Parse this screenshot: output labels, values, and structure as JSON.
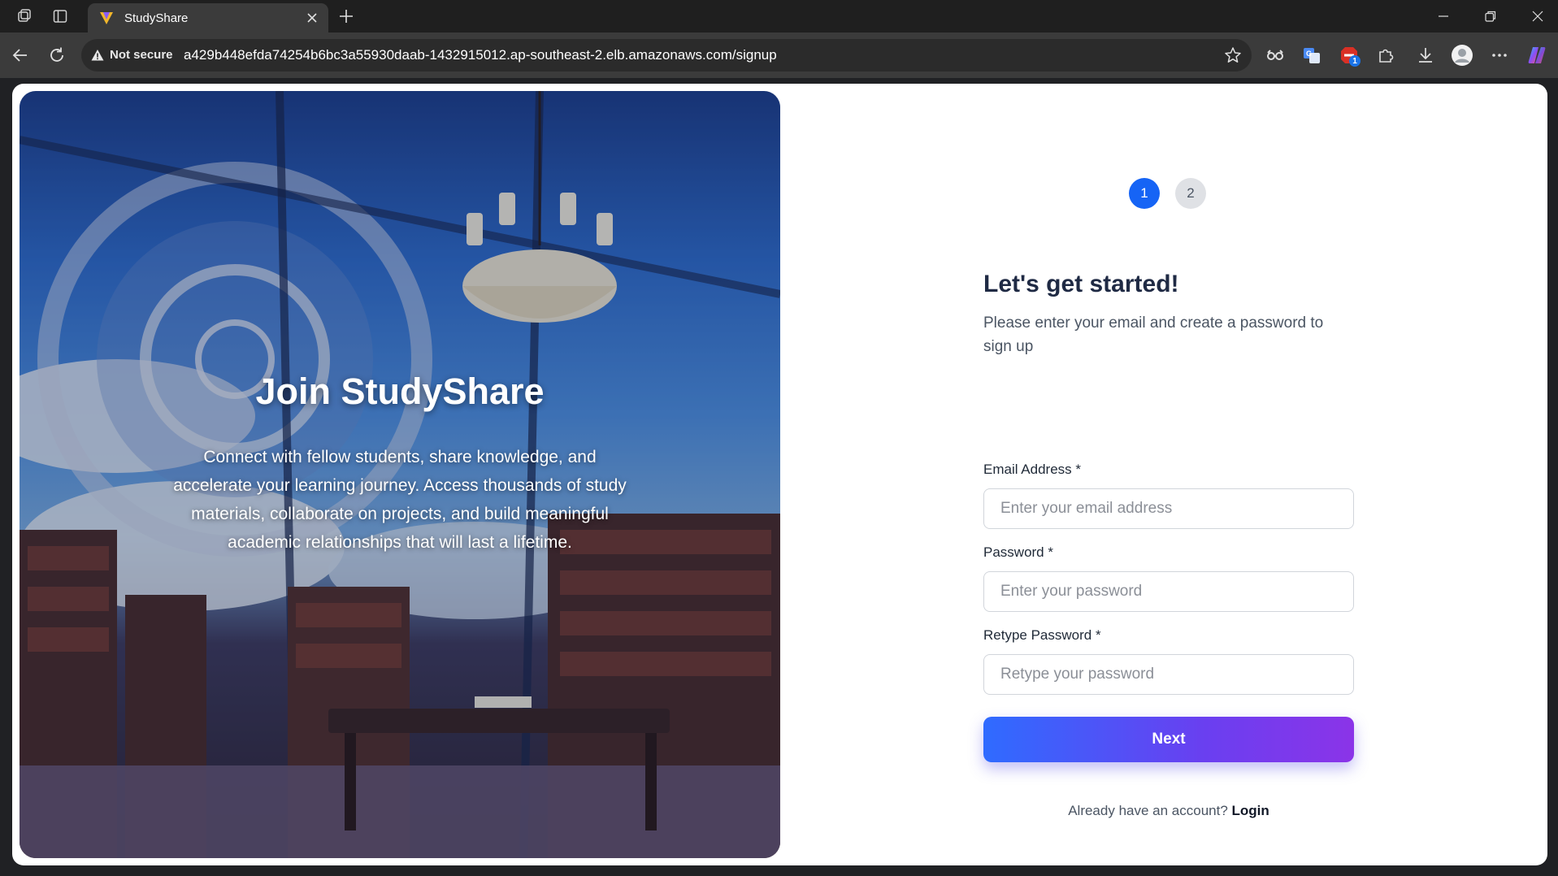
{
  "browser": {
    "tab_title": "StudyShare",
    "security_label": "Not secure",
    "url": "a429b448efda74254b6bc3a55930daab-1432915012.ap-southeast-2.elb.amazonaws.com/signup",
    "extension_badge": "1"
  },
  "hero": {
    "title": "Join StudyShare",
    "description": "Connect with fellow students, share knowledge, and accelerate your learning journey. Access thousands of study materials, collaborate on projects, and build meaningful academic relationships that will last a lifetime."
  },
  "stepper": {
    "steps": [
      "1",
      "2"
    ],
    "active_step": "1"
  },
  "form": {
    "heading": "Let's get started!",
    "subheading": "Please enter your email and create a password to sign up",
    "email": {
      "label": "Email Address *",
      "placeholder": "Enter your email address"
    },
    "password": {
      "label": "Password *",
      "placeholder": "Enter your password"
    },
    "retype_password": {
      "label": "Retype Password *",
      "placeholder": "Retype your password"
    },
    "next_label": "Next",
    "login_prompt": "Already have an account?",
    "login_link": "Login"
  },
  "colors": {
    "primary": "#1664f5",
    "button_gradient_start": "#2f6bff",
    "button_gradient_end": "#8b34e8",
    "heading": "#1f2a44"
  }
}
